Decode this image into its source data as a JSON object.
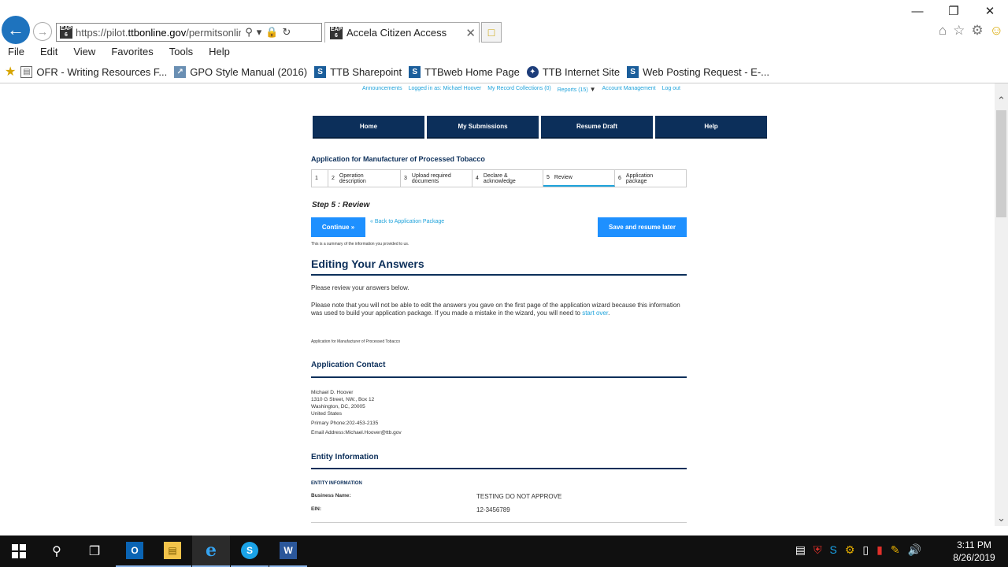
{
  "browser": {
    "url_prefix": "https://pilot.",
    "url_domain": "ttbonline.gov",
    "url_path": "/permitsonline/Cap",
    "tab_title": "Accela Citizen Access",
    "favicon_label": "EAP 6",
    "menu": [
      "File",
      "Edit",
      "View",
      "Favorites",
      "Tools",
      "Help"
    ],
    "favorites": [
      {
        "label": "OFR - Writing Resources F...",
        "icon": "doc-icon"
      },
      {
        "label": "GPO Style Manual (2016)",
        "icon": "gpo-icon"
      },
      {
        "label": "TTB Sharepoint",
        "icon": "sharepoint-icon"
      },
      {
        "label": "TTBweb Home Page",
        "icon": "sharepoint-icon"
      },
      {
        "label": "TTB Internet Site",
        "icon": "ttb-seal-icon"
      },
      {
        "label": "Web Posting Request - E-...",
        "icon": "sharepoint-icon"
      }
    ]
  },
  "toplinks": [
    "Announcements",
    "Logged in as: Michael Hoover",
    "My Record Collections (0)",
    "Reports (15)",
    "Account Management",
    "Log out"
  ],
  "nav": [
    "Home",
    "My Submissions",
    "Resume Draft",
    "Help"
  ],
  "app_title": "Application for Manufacturer of Processed Tobacco",
  "steps": [
    {
      "num": "1",
      "label": "",
      "active": false
    },
    {
      "num": "2",
      "label": "Operation description",
      "active": false
    },
    {
      "num": "3",
      "label": "Upload required documents",
      "active": false
    },
    {
      "num": "4",
      "label": "Declare & acknowledge",
      "active": false
    },
    {
      "num": "5",
      "label": "Review",
      "active": true
    },
    {
      "num": "6",
      "label": "Application package",
      "active": false
    }
  ],
  "step_title": "Step 5 : Review",
  "continue_label": "Continue »",
  "back_link": "« Back to Application Package",
  "save_resume_label": "Save and resume later",
  "summary_text": "This is a summary of the information you provided to us.",
  "editing_heading": "Editing Your Answers",
  "review_text": "Please review your answers below.",
  "note_text": "Please note that you will not be able to edit the answers you gave on the first page of the application wizard because this information was used to build your application package. If you made a mistake in the wizard, you will need to ",
  "start_over": "start over",
  "note_end": ".",
  "subtitle2": "Application for Manufacturer of Processed Tobacco",
  "contact_heading": "Application Contact",
  "contact": {
    "name": "Michael D. Hoover",
    "street": "1310 G Street, NW., Box 12",
    "city": "Washington, DC, 20005",
    "country": "United States",
    "phone": "Primary Phone:202-453-2135",
    "email": "Email Address:Michael.Hoover@ttb.gov"
  },
  "entity_heading": "Entity Information",
  "entity_label": "ENTITY INFORMATION",
  "entity": [
    {
      "key": "Business Name:",
      "value": "TESTING DO NOT APPROVE"
    },
    {
      "key": "EIN:",
      "value": "12-3456789"
    }
  ],
  "clock": {
    "time": "3:11 PM",
    "date": "8/26/2019"
  }
}
